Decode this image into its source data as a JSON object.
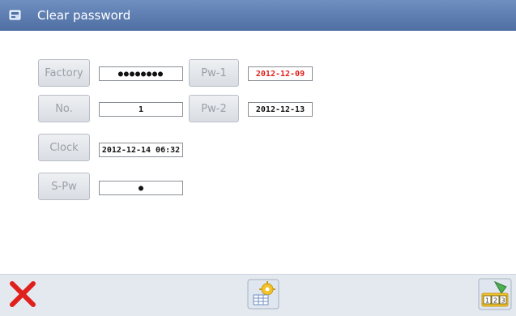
{
  "window": {
    "title": "Clear password",
    "icon": "card-icon"
  },
  "rows": {
    "factory": {
      "label": "Factory",
      "value": "●●●●●●●●"
    },
    "pw1": {
      "label": "Pw-1",
      "value": "2012-12-09",
      "value_color": "#e0201c"
    },
    "no": {
      "label": "No.",
      "value": "1"
    },
    "pw2": {
      "label": "Pw-2",
      "value": "2012-12-13"
    },
    "clock": {
      "label": "Clock",
      "value": "2012-12-14 06:32"
    },
    "spw": {
      "label": "S-Pw",
      "value": "●"
    }
  },
  "toolbar": {
    "cancel_icon": "red-x-icon",
    "settings_icon": "gear-table-icon",
    "keypad_icon": "keypad-123-icon",
    "keypad_text": "123"
  },
  "colors": {
    "titlebar": "#5a7ab0",
    "background": "#ffffff",
    "button": "#dfe3e8",
    "button_text": "#9aa0a8",
    "accent_red": "#e0201c"
  }
}
